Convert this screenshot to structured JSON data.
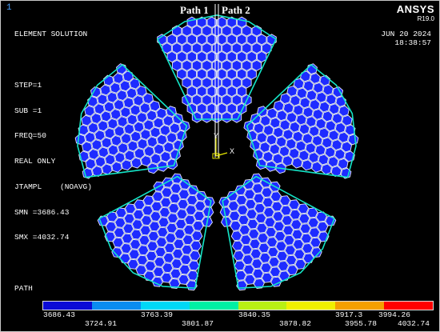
{
  "window_number": "1",
  "info_lines": [
    "ELEMENT SOLUTION",
    "",
    "STEP=1",
    "SUB =1",
    "FREQ=50",
    "REAL ONLY",
    "JTAMPL    (NOAVG)",
    "SMN =3686.43",
    "SMX =4032.74",
    "",
    "PATH"
  ],
  "brand": "ANSYS",
  "version": "R19.0",
  "date": "JUN 20 2024",
  "time": "18:38:57",
  "path1_label": "Path 1",
  "path2_label": "Path 2",
  "axis_labels": {
    "y": "Y",
    "x": "X"
  },
  "colors": {
    "background": "#000000",
    "hex_fill": "#1e2bff",
    "hex_edge": "#e6ecff",
    "legend": [
      "#0b0bd6",
      "#0a8cf0",
      "#00d8f6",
      "#00f0a4",
      "#b8f014",
      "#f0f000",
      "#f4a000",
      "#ff0000"
    ]
  },
  "legend_top_labels": [
    "3686.43",
    "3763.39",
    "3840.35",
    "3917.3",
    "3994.26"
  ],
  "legend_bottom_labels": [
    "3724.91",
    "3801.87",
    "3878.82",
    "3955.78",
    "4032.74"
  ]
}
